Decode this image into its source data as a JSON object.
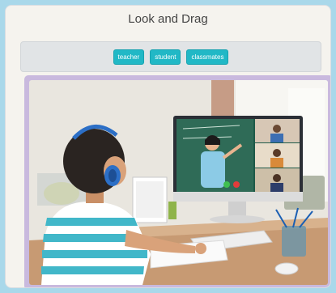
{
  "header": {
    "title": "Look and Drag"
  },
  "chips": [
    {
      "label": "teacher"
    },
    {
      "label": "student"
    },
    {
      "label": "classmates"
    }
  ],
  "colors": {
    "background": "#a9d8ea",
    "chip": "#21b8c6",
    "frame": "#c9b9de"
  }
}
